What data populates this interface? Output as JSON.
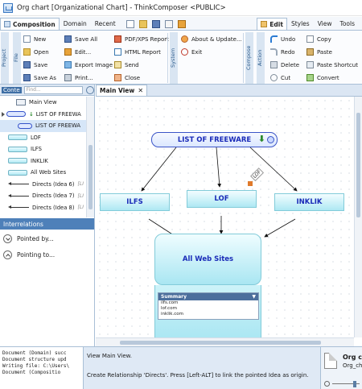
{
  "window": {
    "title": "Org chart [Organizational Chart] - ThinkComposer <PUBLIC>"
  },
  "tabs": {
    "left": [
      "Composition",
      "Domain",
      "Recent"
    ],
    "right": [
      "Edit",
      "Styles",
      "View",
      "Tools"
    ]
  },
  "ribbon": {
    "groups": {
      "project": "Project",
      "file": "File",
      "system": "System",
      "compose": "Compose",
      "action": "Action"
    },
    "file": [
      "New",
      "Open",
      "Save",
      "Save As"
    ],
    "file2": [
      "Save All",
      "Edit...",
      "Export Image",
      "Print..."
    ],
    "file3": [
      "PDF/XPS Report",
      "HTML Report",
      "Send",
      "Close"
    ],
    "system": [
      "About & Update...",
      "Exit"
    ],
    "action": [
      "Undo",
      "Redo",
      "Delete",
      "Cut"
    ],
    "action2": [
      "Copy",
      "Paste",
      "Paste Shortcut",
      "Convert"
    ]
  },
  "left_panel": {
    "header": "Conte",
    "search_placeholder": "Find...",
    "tree": [
      {
        "label": "Main View",
        "extra": ""
      },
      {
        "label": "LIST OF FREEWA",
        "extra": ""
      },
      {
        "label": "LIST OF FREEWA",
        "extra": ""
      },
      {
        "label": "LOF",
        "extra": ""
      },
      {
        "label": "ILFS",
        "extra": ""
      },
      {
        "label": "INKLIK",
        "extra": ""
      },
      {
        "label": "All Web Sites",
        "extra": ""
      },
      {
        "label": "Directs (Idea 6)",
        "extra": "[LI"
      },
      {
        "label": "Directs (Idea 7)",
        "extra": "[LI"
      },
      {
        "label": "Directs (Idea 8)",
        "extra": "[LI"
      }
    ],
    "interrelations": {
      "title": "Interrelations",
      "pointed_by": "Pointed by...",
      "pointing_to": "Pointing to..."
    }
  },
  "main_view": {
    "tab_label": "Main View",
    "close_glyph": "✕",
    "ideas": {
      "root": "LIST OF FREEWARE",
      "lof": "LOF",
      "ilfs": "ILFS",
      "inklik": "INKLIK",
      "all": "All Web Sites"
    },
    "connector_label": "LOF",
    "summary": {
      "title": "Summary",
      "lines": [
        "ilfs.com",
        "lof.com",
        "inklik.com"
      ]
    }
  },
  "console": {
    "lines": [
      "Document (Domain) succ",
      "Document structure upd",
      "Writing file: C:\\Users\\",
      "Document (Compositio"
    ]
  },
  "status": {
    "line1": "View Main View.",
    "line2": "Create Relationship 'Directs'. Press [Left-ALT] to link the pointed Idea as origin."
  },
  "doc_panel": {
    "title": "Org ch",
    "subtitle": "Org_ch"
  },
  "colors": {
    "accent": "#3b55c8",
    "idea_fill": "#aee8f3",
    "panel_header": "#4e80b9",
    "idea_text": "#1a2bb8"
  }
}
